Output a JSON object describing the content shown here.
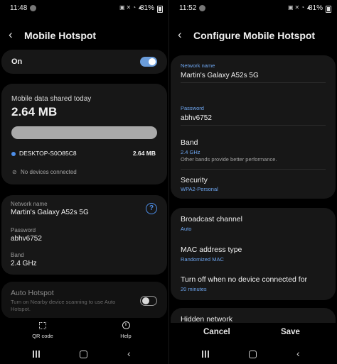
{
  "left": {
    "status": {
      "time": "11:48",
      "battery": "81%"
    },
    "title": "Mobile Hotspot",
    "toggle": {
      "label": "On",
      "state": "on"
    },
    "usage": {
      "label": "Mobile data shared today",
      "amount": "2.64 MB",
      "device_name": "DESKTOP-S0O85C8",
      "device_amount": "2.64 MB",
      "no_devices": "No devices connected"
    },
    "network": {
      "name_label": "Network name",
      "name_value": "Martin's Galaxy A52s 5G",
      "password_label": "Password",
      "password_value": "abhv6752",
      "band_label": "Band",
      "band_value": "2.4 GHz"
    },
    "auto_hotspot": {
      "title": "Auto Hotspot",
      "description_line1": "Turn on Nearby device scanning to use Auto",
      "description_line2": "Hotspot.",
      "state": "off"
    },
    "bottom": {
      "qr_label": "QR code",
      "help_label": "Help"
    }
  },
  "right": {
    "status": {
      "time": "11:52",
      "battery": "81%"
    },
    "title": "Configure Mobile Hotspot",
    "network_name_label": "Network name",
    "network_name_value": "Martin's Galaxy A52s 5G",
    "password_label": "Password",
    "password_value": "abhv6752",
    "band": {
      "title": "Band",
      "value": "2.4 GHz",
      "note": "Other bands provide better performance."
    },
    "security": {
      "title": "Security",
      "value": "WPA2-Personal"
    },
    "broadcast": {
      "title": "Broadcast channel",
      "value": "Auto"
    },
    "mac": {
      "title": "MAC address type",
      "value": "Randomized MAC"
    },
    "turn_off": {
      "title": "Turn off when no device connected for",
      "value": "20 minutes"
    },
    "hidden": {
      "title": "Hidden network"
    },
    "cancel_label": "Cancel",
    "save_label": "Save"
  },
  "colors": {
    "accent": "#6ea6f0",
    "card": "#171717",
    "background": "#000000"
  }
}
